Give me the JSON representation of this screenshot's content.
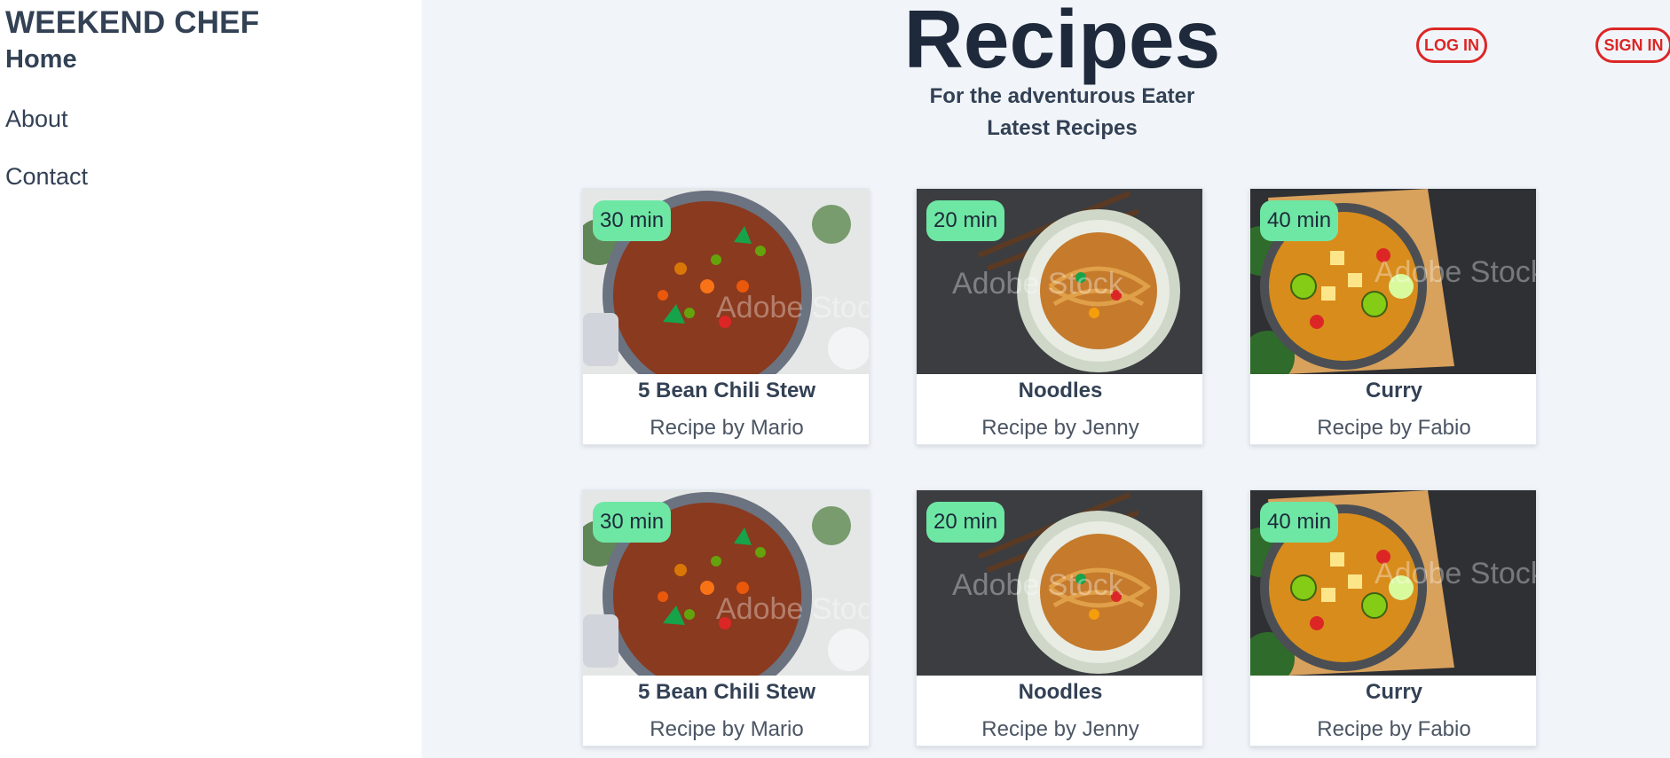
{
  "sidebar": {
    "brand": "WEEKEND CHEF",
    "nav": [
      {
        "label": "Home"
      },
      {
        "label": "About"
      },
      {
        "label": "Contact"
      }
    ]
  },
  "header": {
    "title": "Recipes",
    "subtitle": "For the adventurous Eater",
    "login_label": "LOG IN",
    "signin_label": "SIGN IN"
  },
  "section": {
    "title": "Latest Recipes"
  },
  "recipes": [
    {
      "time": "30 min",
      "title": "5 Bean Chili Stew",
      "author": "Recipe by Mario",
      "image": "chili-stew-image"
    },
    {
      "time": "20 min",
      "title": "Noodles",
      "author": "Recipe by Jenny",
      "image": "noodles-image"
    },
    {
      "time": "40 min",
      "title": "Curry",
      "author": "Recipe by Fabio",
      "image": "curry-image"
    },
    {
      "time": "30 min",
      "title": "5 Bean Chili Stew",
      "author": "Recipe by Mario",
      "image": "chili-stew-image"
    },
    {
      "time": "20 min",
      "title": "Noodles",
      "author": "Recipe by Jenny",
      "image": "noodles-image"
    },
    {
      "time": "40 min",
      "title": "Curry",
      "author": "Recipe by Fabio",
      "image": "curry-image"
    }
  ],
  "colors": {
    "accent": "#dc2626",
    "badge": "#6ee7a4",
    "background": "#f1f5f9",
    "text": "#334155"
  }
}
